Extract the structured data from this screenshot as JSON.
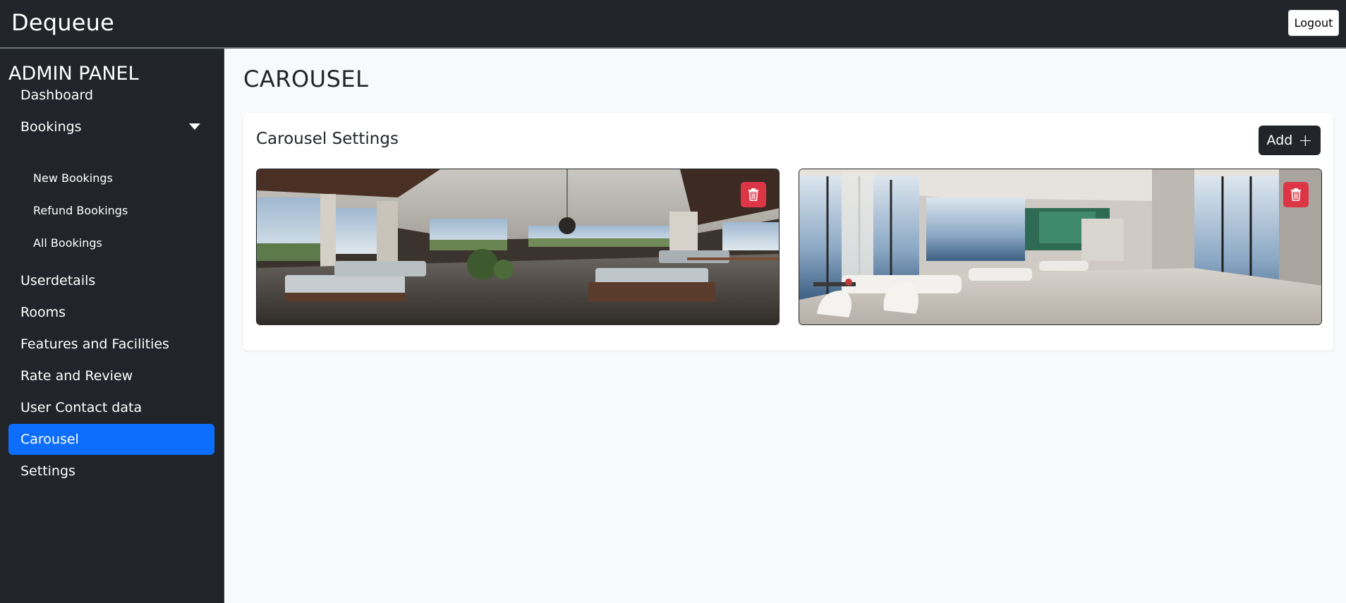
{
  "app": {
    "brand": "Dequeue",
    "logout_label": "Logout"
  },
  "sidebar": {
    "title": "ADMIN PANEL",
    "items": [
      {
        "label": "Dashboard"
      },
      {
        "label": "Bookings"
      },
      {
        "label": "Userdetails"
      },
      {
        "label": "Rooms"
      },
      {
        "label": "Features and Facilities"
      },
      {
        "label": "Rate and Review"
      },
      {
        "label": "User Contact data"
      },
      {
        "label": "Carousel"
      },
      {
        "label": "Settings"
      }
    ],
    "bookings_sub": [
      {
        "label": "New Bookings"
      },
      {
        "label": "Refund Bookings"
      },
      {
        "label": "All Bookings"
      }
    ],
    "active_item": "Carousel"
  },
  "main": {
    "page_title": "CAROUSEL",
    "card_title": "Carousel Settings",
    "add_label": "Add",
    "images": [
      {
        "icon": "trash-icon"
      },
      {
        "icon": "trash-icon"
      }
    ]
  },
  "colors": {
    "accent": "#0d6efd",
    "dark": "#212529",
    "danger": "#dc3545"
  }
}
